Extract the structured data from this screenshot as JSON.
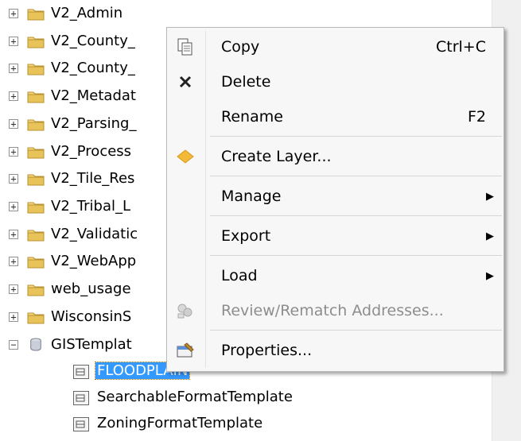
{
  "tree": {
    "folders": [
      {
        "label": "V2_Admin"
      },
      {
        "label": "V2_County_"
      },
      {
        "label": "V2_County_"
      },
      {
        "label": "V2_Metadat"
      },
      {
        "label": "V2_Parsing_"
      },
      {
        "label": "V2_Process"
      },
      {
        "label": "V2_Tile_Res"
      },
      {
        "label": "V2_Tribal_L"
      },
      {
        "label": "V2_Validatic"
      },
      {
        "label": "V2_WebApp"
      },
      {
        "label": "web_usage"
      },
      {
        "label": "WisconsinS"
      }
    ],
    "expander_collapsed": "+",
    "expander_expanded": "−",
    "database": {
      "label": "GISTemplat"
    },
    "children": [
      {
        "label": "FLOODPLAIN",
        "selected": true
      },
      {
        "label": "SearchableFormatTemplate",
        "selected": false
      },
      {
        "label": "ZoningFormatTemplate",
        "selected": false
      }
    ]
  },
  "context_menu": {
    "items": [
      {
        "label": "Copy",
        "shortcut": "Ctrl+C",
        "icon": "copy-icon",
        "submenu": false,
        "disabled": false
      },
      {
        "label": "Delete",
        "shortcut": "",
        "icon": "delete-icon",
        "submenu": false,
        "disabled": false
      },
      {
        "label": "Rename",
        "shortcut": "F2",
        "icon": "",
        "submenu": false,
        "disabled": false
      },
      {
        "label": "Create Layer...",
        "shortcut": "",
        "icon": "create-layer-icon",
        "submenu": false,
        "disabled": false
      },
      {
        "label": "Manage",
        "shortcut": "",
        "icon": "",
        "submenu": true,
        "disabled": false
      },
      {
        "label": "Export",
        "shortcut": "",
        "icon": "",
        "submenu": true,
        "disabled": false
      },
      {
        "label": "Load",
        "shortcut": "",
        "icon": "",
        "submenu": true,
        "disabled": false
      },
      {
        "label": "Review/Rematch Addresses...",
        "shortcut": "",
        "icon": "rematch-icon",
        "submenu": false,
        "disabled": true
      },
      {
        "label": "Properties...",
        "shortcut": "",
        "icon": "properties-icon",
        "submenu": false,
        "disabled": false
      }
    ],
    "submenu_arrow": "▶"
  },
  "colors": {
    "selection": "#3399ff",
    "folder": "#e8c35a",
    "accent_diamond": "#f5b93a"
  }
}
